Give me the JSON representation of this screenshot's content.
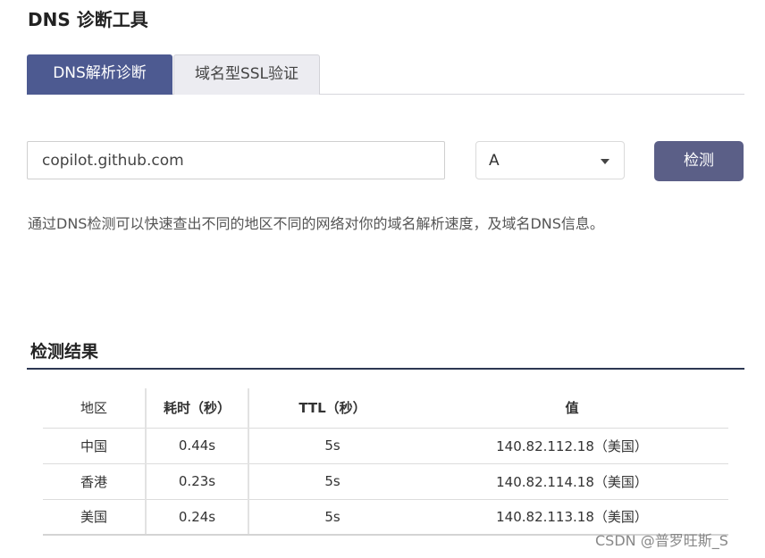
{
  "page": {
    "title": "DNS 诊断工具"
  },
  "tabs": [
    {
      "label": "DNS解析诊断",
      "active": true
    },
    {
      "label": "域名型SSL验证",
      "active": false
    }
  ],
  "form": {
    "domain_value": "copilot.github.com",
    "record_type": "A",
    "check_label": "检测"
  },
  "description": "通过DNS检测可以快速查出不同的地区不同的网络对你的域名解析速度，及域名DNS信息。",
  "results": {
    "title": "检测结果",
    "headers": [
      "地区",
      "耗时（秒）",
      "TTL（秒）",
      "值"
    ],
    "rows": [
      [
        "中国",
        "0.44s",
        "5s",
        "140.82.112.18（美国）"
      ],
      [
        "香港",
        "0.23s",
        "5s",
        "140.82.114.18（美国）"
      ],
      [
        "美国",
        "0.24s",
        "5s",
        "140.82.113.18（美国）"
      ]
    ]
  },
  "watermark": "CSDN @普罗旺斯_S",
  "colors": {
    "accent": "#4d5a91",
    "button": "#5b5f87",
    "section_line": "#2c3752"
  }
}
